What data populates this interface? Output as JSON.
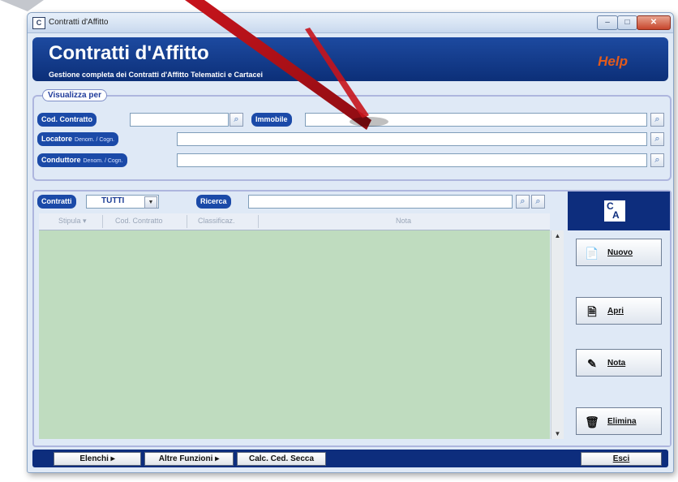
{
  "window": {
    "title": "Contratti d'Affitto"
  },
  "header": {
    "title": "Contratti d'Affitto",
    "subtitle": "Gestione completa dei Contratti d'Affitto Telematici e Cartacei",
    "help": "Help"
  },
  "filter": {
    "legend": "Visualizza per",
    "cod_contratto": {
      "label": "Cod. Contratto",
      "value": ""
    },
    "immobile": {
      "label": "Immobile",
      "value": ""
    },
    "locatore": {
      "label": "Locatore",
      "hint": "Denom. / Cogn.",
      "value": ""
    },
    "conduttore": {
      "label": "Conduttore",
      "hint": "Denom. / Cogn.",
      "value": ""
    }
  },
  "list": {
    "contratti_label": "Contratti",
    "contratti_value": "TUTTI",
    "ricerca_label": "Ricerca",
    "ricerca_value": "",
    "columns": [
      "Stipula ▾",
      "Cod. Contratto",
      "Classificaz.",
      "Nota"
    ],
    "rows": []
  },
  "actions": {
    "logo": "CA",
    "nuovo": "Nuovo",
    "apri": "Apri",
    "nota": "Nota",
    "elimina": "Elimina"
  },
  "footer": {
    "elenchi": "Elenchi ▸",
    "altre_funzioni": "Altre Funzioni ▸",
    "calc": "Calc. Ced. Secca",
    "esci": "Esci"
  },
  "colors": {
    "header_blue": "#0c2f78",
    "help_orange": "#e25a1b",
    "grid_green": "#bfdcbf",
    "pill_blue": "#1b4aa8"
  },
  "icons": [
    "app-icon",
    "search-icon",
    "dropdown-icon",
    "new-document-icon",
    "open-document-icon",
    "note-pencil-icon",
    "delete-document-icon"
  ]
}
